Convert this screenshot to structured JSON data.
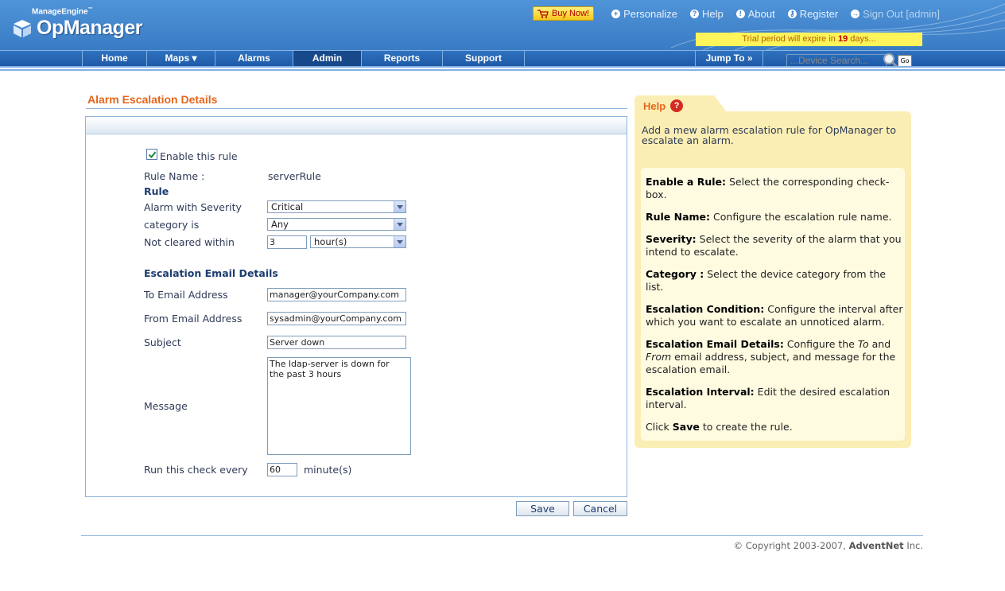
{
  "brand": {
    "vendor": "ManageEngine",
    "tm": "™",
    "product": "OpManager"
  },
  "toplinks": {
    "buy": "Buy Now!",
    "personalize": "Personalize",
    "help": "Help",
    "about": "About",
    "register": "Register",
    "signout": "Sign Out [admin]"
  },
  "trial": {
    "prefix": "Trial period will expire in",
    "days": "19",
    "suffix": "days..."
  },
  "nav": {
    "items": [
      {
        "label": "Home"
      },
      {
        "label": "Maps ▾"
      },
      {
        "label": "Alarms"
      },
      {
        "label": "Admin"
      },
      {
        "label": "Reports"
      },
      {
        "label": "Support"
      }
    ],
    "active": "Admin",
    "jump": "Jump To »",
    "search_placeholder": "...Device Search...",
    "go": "Go"
  },
  "page": {
    "title": "Alarm Escalation Details"
  },
  "form": {
    "enable_label": "Enable this rule",
    "enabled": true,
    "rule_name_label": "Rule Name :",
    "rule_name_value": "serverRule",
    "rule_section": "Rule",
    "severity_label": "Alarm with Severity",
    "severity_value": "Critical",
    "category_label": "category is",
    "category_value": "Any",
    "not_cleared_label": "Not cleared within",
    "not_cleared_value": "3",
    "not_cleared_unit": "hour(s)",
    "email_section": "Escalation Email Details",
    "to_label": "To Email Address",
    "to_value": "manager@yourCompany.com",
    "from_label": "From Email Address",
    "from_value": "sysadmin@yourCompany.com",
    "subject_label": "Subject",
    "subject_value": "Server down",
    "message_label": "Message",
    "message_value": "The ldap-server is down for\nthe past 3 hours",
    "run_label": "Run this check every",
    "run_value": "60",
    "run_unit": "minute(s)",
    "save": "Save",
    "cancel": "Cancel"
  },
  "help": {
    "title": "Help",
    "intro": "Add a mew alarm escalation rule for OpManager to escalate an alarm.",
    "items": [
      {
        "term": "Enable a Rule:",
        "text": "Select the corresponding check-box."
      },
      {
        "term": "Rule Name:",
        "text": "Configure the escalation rule name."
      },
      {
        "term": "Severity:",
        "text": "Select the severity of the alarm that you intend to escalate."
      },
      {
        "term": "Category :",
        "text": "Select the device category from the list."
      },
      {
        "term": "Escalation Condition:",
        "text": "Configure the interval after which you want to escalate an unnoticed alarm."
      },
      {
        "term": "Escalation Email Details:",
        "text_before": "Configure the",
        "to": "To",
        "text_mid": "and",
        "from": "From",
        "text_after": "email address, subject, and message for the escalation email."
      },
      {
        "term": "Escalation Interval:",
        "text": "Edit the desired escalation interval."
      },
      {
        "text_before": "Click",
        "term": "Save",
        "text": "to create the rule."
      }
    ]
  },
  "footer": {
    "copyright": "© Copyright 2003-2007,",
    "company": "AdventNet",
    "suffix": "Inc."
  },
  "colors": {
    "header": "#4f93d8",
    "nav": "#1e5aa7",
    "accent": "#e4661c",
    "help_bg": "#fbeeb4"
  }
}
